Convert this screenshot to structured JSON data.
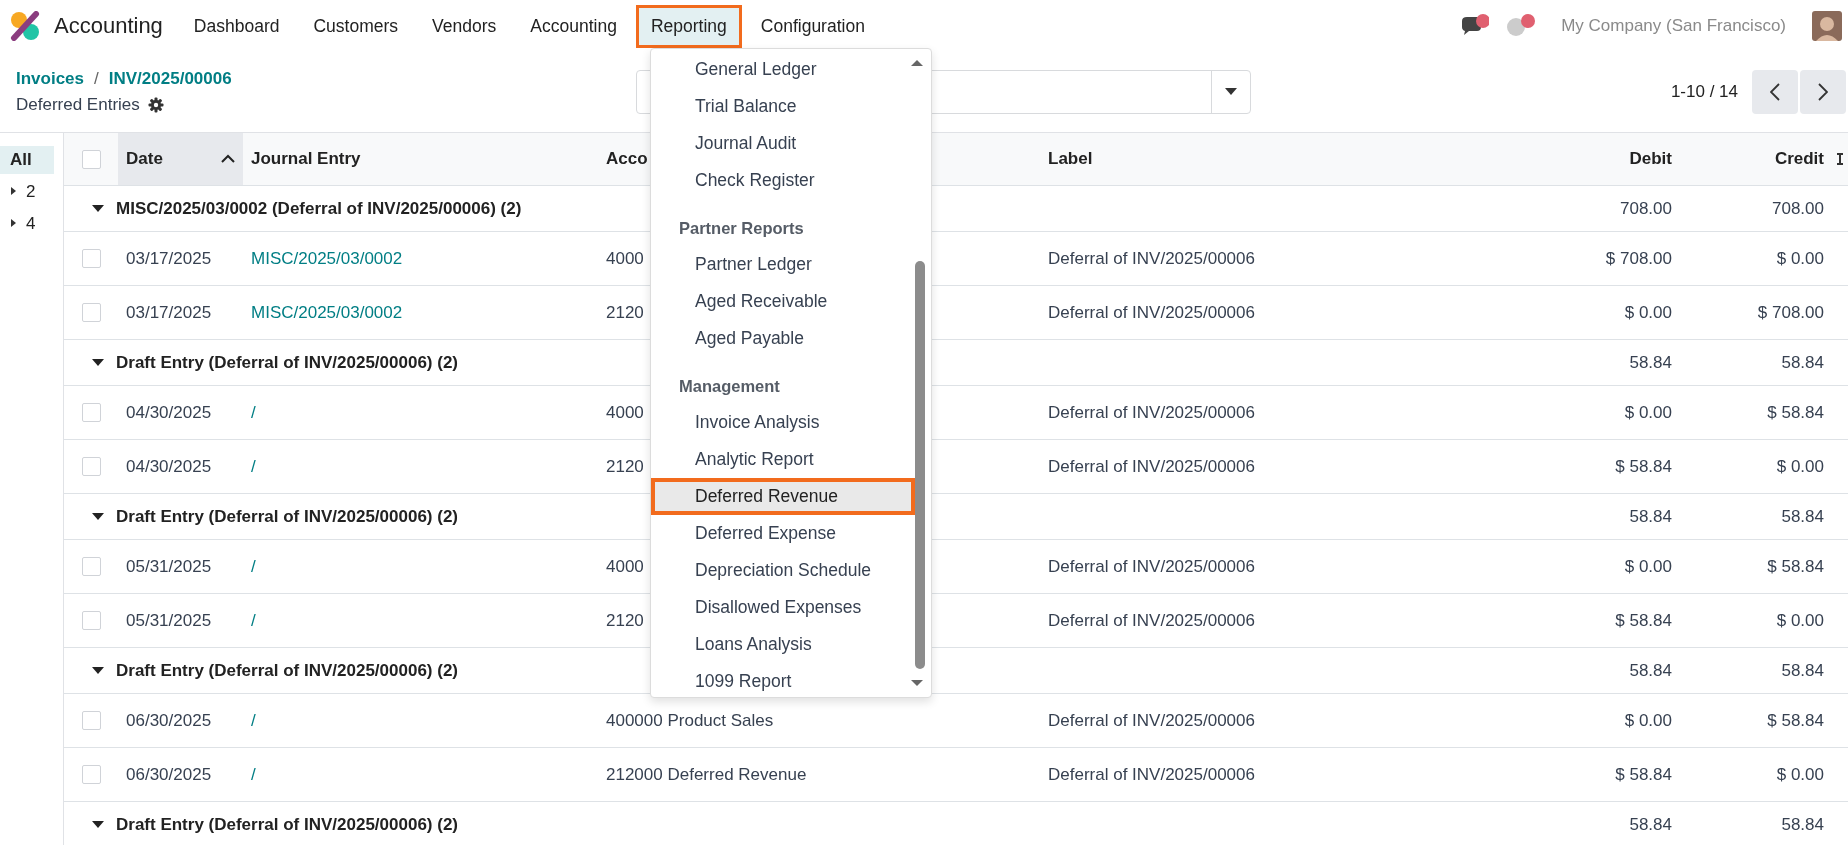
{
  "app": {
    "name": "Accounting"
  },
  "nav_items": [
    {
      "label": "Dashboard",
      "selected": false
    },
    {
      "label": "Customers",
      "selected": false
    },
    {
      "label": "Vendors",
      "selected": false
    },
    {
      "label": "Accounting",
      "selected": false
    },
    {
      "label": "Reporting",
      "selected": true
    },
    {
      "label": "Configuration",
      "selected": false
    }
  ],
  "systray": {
    "company": "My Company (San Francisco)"
  },
  "breadcrumb": {
    "links": [
      "Invoices",
      "INV/2025/00006"
    ],
    "separator": "/"
  },
  "page_title": "Deferred Entries",
  "pager": {
    "range": "1-10 / 14"
  },
  "group_panel": [
    {
      "kind": "all",
      "label": "All",
      "selected": true
    },
    {
      "kind": "group",
      "label": "2",
      "selected": false,
      "expanded": false
    },
    {
      "kind": "group",
      "label": "4",
      "selected": false,
      "expanded": false
    }
  ],
  "table": {
    "select_all_checked": false,
    "columns": [
      {
        "label": "Date",
        "sorted": true
      },
      {
        "label": "Journal Entry",
        "sorted": false
      },
      {
        "label": "Acco",
        "sorted": false
      },
      {
        "label": "Label",
        "sorted": false
      },
      {
        "label": "Debit",
        "sorted": false
      },
      {
        "label": "Credit",
        "sorted": false
      }
    ],
    "rows": [
      {
        "kind": "group",
        "label": "MISC/2025/03/0002 (Deferral of INV/2025/00006) (2)",
        "expanded": true,
        "debit": "708.00",
        "credit": "708.00"
      },
      {
        "kind": "line",
        "checked": false,
        "date": "03/17/2025",
        "entry": "MISC/2025/03/0002",
        "account": "4000",
        "label": "Deferral of INV/2025/00006",
        "debit": "$ 708.00",
        "credit": "$ 0.00"
      },
      {
        "kind": "line",
        "checked": false,
        "date": "03/17/2025",
        "entry": "MISC/2025/03/0002",
        "account": "2120",
        "label": "Deferral of INV/2025/00006",
        "debit": "$ 0.00",
        "credit": "$ 708.00"
      },
      {
        "kind": "group",
        "label": "Draft Entry (Deferral of INV/2025/00006) (2)",
        "expanded": true,
        "debit": "58.84",
        "credit": "58.84"
      },
      {
        "kind": "line",
        "checked": false,
        "date": "04/30/2025",
        "entry": "/",
        "account": "4000",
        "label": "Deferral of INV/2025/00006",
        "debit": "$ 0.00",
        "credit": "$ 58.84"
      },
      {
        "kind": "line",
        "checked": false,
        "date": "04/30/2025",
        "entry": "/",
        "account": "2120",
        "label": "Deferral of INV/2025/00006",
        "debit": "$ 58.84",
        "credit": "$ 0.00"
      },
      {
        "kind": "group",
        "label": "Draft Entry (Deferral of INV/2025/00006) (2)",
        "expanded": true,
        "debit": "58.84",
        "credit": "58.84"
      },
      {
        "kind": "line",
        "checked": false,
        "date": "05/31/2025",
        "entry": "/",
        "account": "4000",
        "label": "Deferral of INV/2025/00006",
        "debit": "$ 0.00",
        "credit": "$ 58.84"
      },
      {
        "kind": "line",
        "checked": false,
        "date": "05/31/2025",
        "entry": "/",
        "account": "2120",
        "label": "Deferral of INV/2025/00006",
        "debit": "$ 58.84",
        "credit": "$ 0.00"
      },
      {
        "kind": "group",
        "label": "Draft Entry (Deferral of INV/2025/00006) (2)",
        "expanded": true,
        "debit": "58.84",
        "credit": "58.84"
      },
      {
        "kind": "line",
        "checked": false,
        "date": "06/30/2025",
        "entry": "/",
        "account": "400000 Product Sales",
        "label": "Deferral of INV/2025/00006",
        "debit": "$ 0.00",
        "credit": "$ 58.84"
      },
      {
        "kind": "line",
        "checked": false,
        "date": "06/30/2025",
        "entry": "/",
        "account": "212000 Deferred Revenue",
        "label": "Deferral of INV/2025/00006",
        "debit": "$ 58.84",
        "credit": "$ 0.00"
      },
      {
        "kind": "group",
        "label": "Draft Entry (Deferral of INV/2025/00006) (2)",
        "expanded": true,
        "debit": "58.84",
        "credit": "58.84"
      }
    ]
  },
  "reporting_menu": [
    {
      "kind": "item",
      "label": "General Ledger",
      "selected": false
    },
    {
      "kind": "item",
      "label": "Trial Balance",
      "selected": false
    },
    {
      "kind": "item",
      "label": "Journal Audit",
      "selected": false
    },
    {
      "kind": "item",
      "label": "Check Register",
      "selected": false
    },
    {
      "kind": "header",
      "label": "Partner Reports"
    },
    {
      "kind": "item",
      "label": "Partner Ledger",
      "selected": false
    },
    {
      "kind": "item",
      "label": "Aged Receivable",
      "selected": false
    },
    {
      "kind": "item",
      "label": "Aged Payable",
      "selected": false
    },
    {
      "kind": "header",
      "label": "Management"
    },
    {
      "kind": "item",
      "label": "Invoice Analysis",
      "selected": false
    },
    {
      "kind": "item",
      "label": "Analytic Report",
      "selected": false
    },
    {
      "kind": "item",
      "label": "Deferred Revenue",
      "selected": true
    },
    {
      "kind": "item",
      "label": "Deferred Expense",
      "selected": false
    },
    {
      "kind": "item",
      "label": "Depreciation Schedule",
      "selected": false
    },
    {
      "kind": "item",
      "label": "Disallowed Expenses",
      "selected": false
    },
    {
      "kind": "item",
      "label": "Loans Analysis",
      "selected": false
    },
    {
      "kind": "item",
      "label": "1099 Report",
      "selected": false
    }
  ]
}
